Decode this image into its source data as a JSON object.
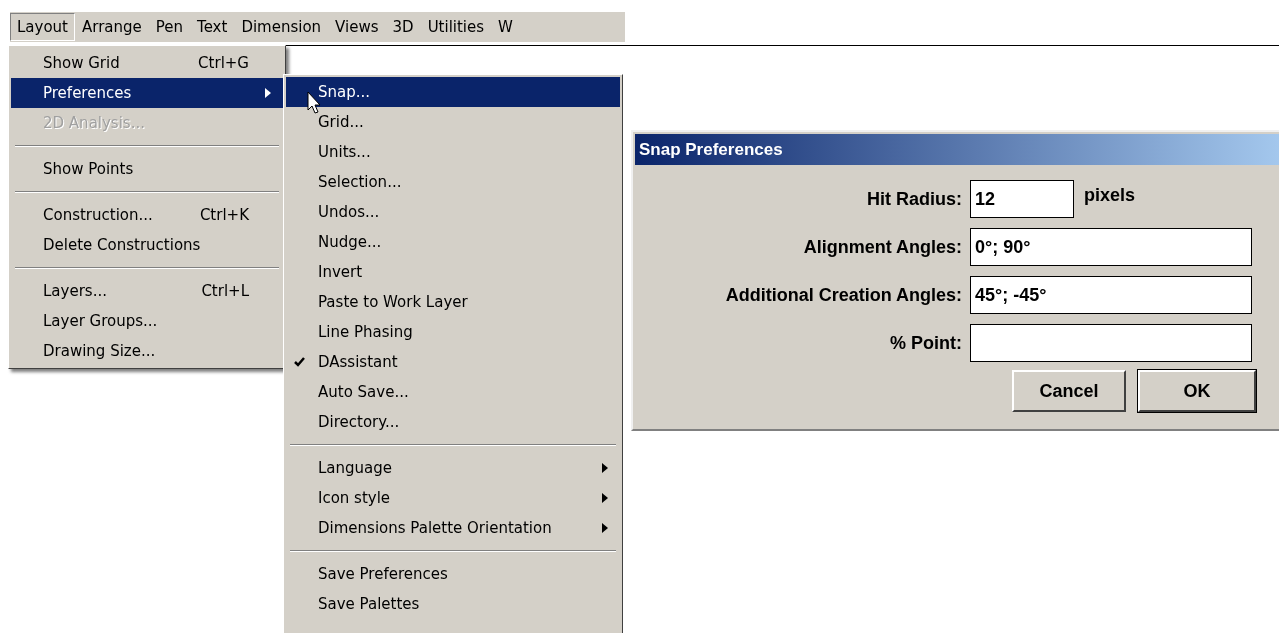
{
  "menubar": {
    "items": [
      {
        "label": "Layout",
        "selected": true
      },
      {
        "label": "Arrange",
        "selected": false
      },
      {
        "label": "Pen",
        "selected": false
      },
      {
        "label": "Text",
        "selected": false
      },
      {
        "label": "Dimension",
        "selected": false
      },
      {
        "label": "Views",
        "selected": false
      },
      {
        "label": "3D",
        "selected": false
      },
      {
        "label": "Utilities",
        "selected": false
      },
      {
        "label": "W",
        "selected": false
      }
    ]
  },
  "layout_menu": {
    "items": [
      {
        "kind": "item",
        "label": "Show Grid",
        "shortcut": "Ctrl+G",
        "disabled": false,
        "selected": false,
        "submenu": false
      },
      {
        "kind": "item",
        "label": "Preferences",
        "disabled": false,
        "selected": true,
        "submenu": true
      },
      {
        "kind": "item",
        "label": "2D Analysis...",
        "disabled": true,
        "selected": false,
        "submenu": false
      },
      {
        "kind": "separator"
      },
      {
        "kind": "item",
        "label": "Show Points",
        "disabled": false,
        "selected": false,
        "submenu": false
      },
      {
        "kind": "separator"
      },
      {
        "kind": "item",
        "label": "Construction...",
        "shortcut": "Ctrl+K",
        "disabled": false,
        "selected": false,
        "submenu": false
      },
      {
        "kind": "item",
        "label": "Delete Constructions",
        "disabled": false,
        "selected": false,
        "submenu": false
      },
      {
        "kind": "separator"
      },
      {
        "kind": "item",
        "label": "Layers...",
        "shortcut": "Ctrl+L",
        "disabled": false,
        "selected": false,
        "submenu": false
      },
      {
        "kind": "item",
        "label": "Layer Groups...",
        "disabled": false,
        "selected": false,
        "submenu": false
      },
      {
        "kind": "item",
        "label": "Drawing Size...",
        "disabled": false,
        "selected": false,
        "submenu": false
      }
    ]
  },
  "preferences_menu": {
    "items": [
      {
        "kind": "item",
        "label": "Snap...",
        "selected": true,
        "checked": false,
        "submenu": false
      },
      {
        "kind": "item",
        "label": "Grid...",
        "selected": false,
        "checked": false,
        "submenu": false
      },
      {
        "kind": "item",
        "label": "Units...",
        "selected": false,
        "checked": false,
        "submenu": false
      },
      {
        "kind": "item",
        "label": "Selection...",
        "selected": false,
        "checked": false,
        "submenu": false
      },
      {
        "kind": "item",
        "label": "Undos...",
        "selected": false,
        "checked": false,
        "submenu": false
      },
      {
        "kind": "item",
        "label": "Nudge...",
        "selected": false,
        "checked": false,
        "submenu": false
      },
      {
        "kind": "item",
        "label": "Invert",
        "selected": false,
        "checked": false,
        "submenu": false
      },
      {
        "kind": "item",
        "label": "Paste to Work Layer",
        "selected": false,
        "checked": false,
        "submenu": false
      },
      {
        "kind": "item",
        "label": "Line Phasing",
        "selected": false,
        "checked": false,
        "submenu": false
      },
      {
        "kind": "item",
        "label": "DAssistant",
        "selected": false,
        "checked": true,
        "submenu": false
      },
      {
        "kind": "item",
        "label": "Auto Save...",
        "selected": false,
        "checked": false,
        "submenu": false
      },
      {
        "kind": "item",
        "label": "Directory...",
        "selected": false,
        "checked": false,
        "submenu": false
      },
      {
        "kind": "separator"
      },
      {
        "kind": "item",
        "label": "Language",
        "selected": false,
        "checked": false,
        "submenu": true
      },
      {
        "kind": "item",
        "label": "Icon style",
        "selected": false,
        "checked": false,
        "submenu": true
      },
      {
        "kind": "item",
        "label": "Dimensions Palette Orientation",
        "selected": false,
        "checked": false,
        "submenu": true
      },
      {
        "kind": "separator"
      },
      {
        "kind": "item",
        "label": "Save Preferences",
        "selected": false,
        "checked": false,
        "submenu": false
      },
      {
        "kind": "item",
        "label": "Save Palettes",
        "selected": false,
        "checked": false,
        "submenu": false
      }
    ]
  },
  "dialog": {
    "title": "Snap Preferences",
    "fields": [
      {
        "label": "Hit Radius:",
        "value": "12",
        "unit": "pixels"
      },
      {
        "label": "Alignment Angles:",
        "value": "0°; 90°"
      },
      {
        "label": "Additional Creation Angles:",
        "value": "45°; -45°"
      },
      {
        "label": "% Point:"
      }
    ],
    "buttons": [
      {
        "label": "Cancel",
        "default": false
      },
      {
        "label": "OK",
        "default": true
      }
    ]
  }
}
